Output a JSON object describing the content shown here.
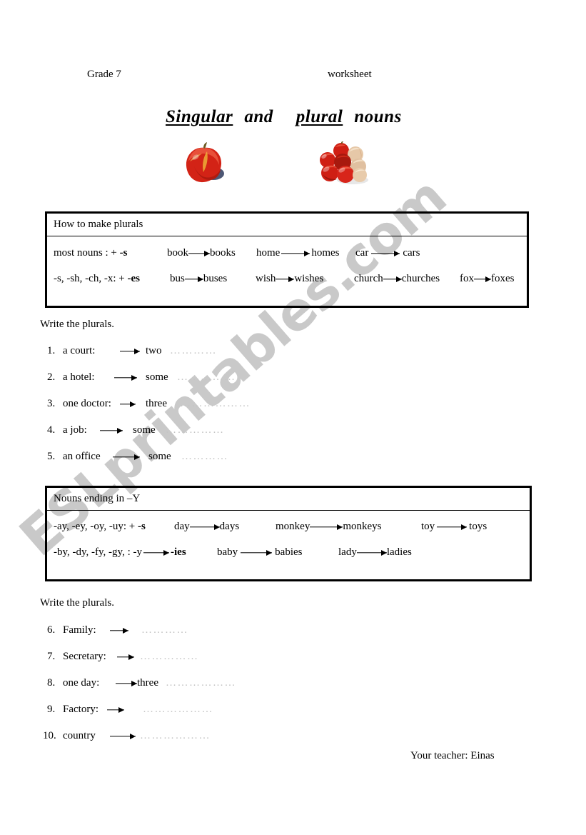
{
  "header": {
    "left": "Grade 7",
    "right": "worksheet"
  },
  "title": {
    "word1": "Singular",
    "word2": "and",
    "word3": "plural",
    "word4": "nouns"
  },
  "images": {
    "single_label": "single-apple-image",
    "group_label": "apples-group-image"
  },
  "watermark": {
    "text": "ESLprintables.com",
    "color": "#c9c9c9"
  },
  "table1": {
    "title": "How to make plurals",
    "rows": [
      {
        "rule": "most nouns : + ",
        "rule_bold": "-s",
        "examples": [
          {
            "singular": "book",
            "plural": "books"
          },
          {
            "singular": "home",
            "plural": "homes"
          },
          {
            "singular": "car",
            "plural": "cars"
          }
        ]
      },
      {
        "rule": "-s, -sh, -ch, -x: + ",
        "rule_bold": "-es",
        "examples": [
          {
            "singular": "bus",
            "plural": "buses"
          },
          {
            "singular": "wish",
            "plural": "wishes"
          },
          {
            "singular": "church",
            "plural": "churches"
          },
          {
            "singular": "fox",
            "plural": "foxes"
          }
        ]
      }
    ]
  },
  "exercise1": {
    "prompt": "Write the plurals.",
    "items": [
      {
        "num": "1.",
        "word": "a court:",
        "after": "two",
        "dots": "…………"
      },
      {
        "num": "2.",
        "word": "a hotel:",
        "after": "some",
        "dots": "……………"
      },
      {
        "num": "3.",
        "word": "one doctor:",
        "after": "three",
        "dots": "………………"
      },
      {
        "num": "4.",
        "word": "a job:",
        "after": "some",
        "dots": "……………"
      },
      {
        "num": "5.",
        "word": "an office",
        "after": "some",
        "dots": "…………"
      }
    ]
  },
  "table2": {
    "title": "Nouns ending in –Y",
    "rows": [
      {
        "rule": "-ay, -ey, -oy, -uy: + ",
        "rule_bold": "-s",
        "examples": [
          {
            "singular": "day",
            "plural": "days"
          },
          {
            "singular": "monkey",
            "plural": "monkeys"
          },
          {
            "singular": "toy",
            "plural": "toys"
          }
        ]
      },
      {
        "rule": "-by, -dy, -fy, -gy, : -y",
        "rule_bold": "-ies",
        "examples": [
          {
            "singular": "baby",
            "plural": "babies"
          },
          {
            "singular": "lady",
            "plural": "ladies"
          }
        ]
      }
    ]
  },
  "exercise2": {
    "prompt": "Write the plurals.",
    "items": [
      {
        "num": "6.",
        "word": "Family:",
        "after": "",
        "dots": "…………"
      },
      {
        "num": "7.",
        "word": "Secretary:",
        "after": "",
        "dots": "……………"
      },
      {
        "num": "8.",
        "word": "one day:",
        "after": "three",
        "dots": "………………"
      },
      {
        "num": "9.",
        "word": "Factory:",
        "after": "",
        "dots": "………………"
      },
      {
        "num": "10.",
        "word": "country",
        "after": "",
        "dots": "………………"
      }
    ]
  },
  "footer": {
    "text": "Your teacher: Einas"
  }
}
